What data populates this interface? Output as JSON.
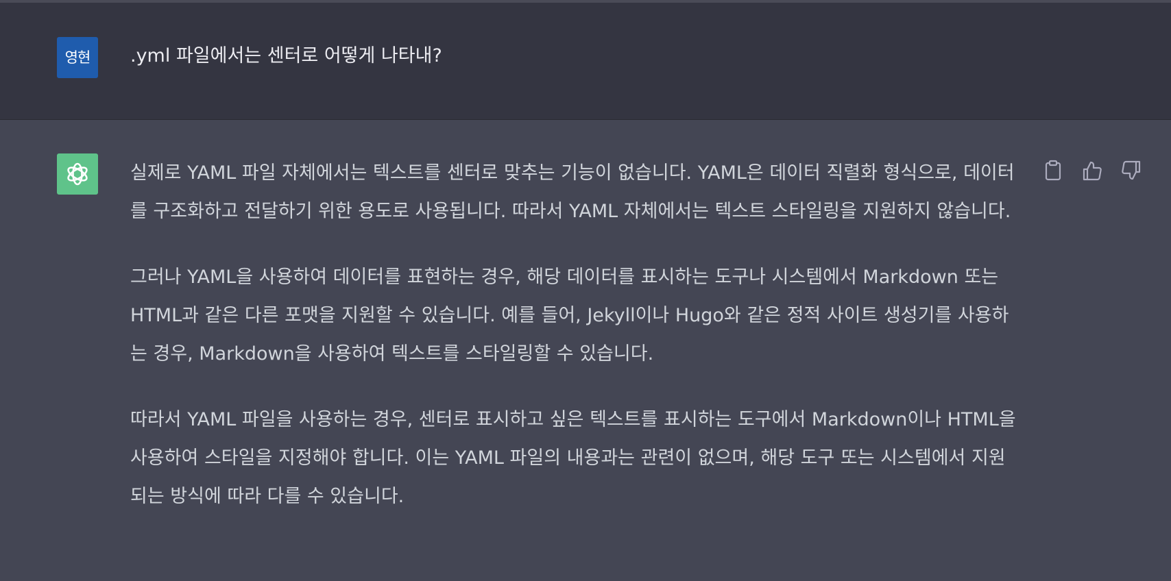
{
  "user_message": {
    "avatar_label": "영현",
    "text": ".yml 파일에서는 센터로 어떻게 나타내?"
  },
  "assistant_message": {
    "paragraphs": [
      "실제로 YAML 파일 자체에서는 텍스트를 센터로 맞추는 기능이 없습니다. YAML은 데이터 직렬화 형식으로, 데이터를 구조화하고 전달하기 위한 용도로 사용됩니다. 따라서 YAML 자체에서는 텍스트 스타일링을 지원하지 않습니다.",
      "그러나 YAML을 사용하여 데이터를 표현하는 경우, 해당 데이터를 표시하는 도구나 시스템에서 Markdown 또는 HTML과 같은 다른 포맷을 지원할 수 있습니다. 예를 들어, Jekyll이나 Hugo와 같은 정적 사이트 생성기를 사용하는 경우, Markdown을 사용하여 텍스트를 스타일링할 수 있습니다.",
      "따라서 YAML 파일을 사용하는 경우, 센터로 표시하고 싶은 텍스트를 표시하는 도구에서 Markdown이나 HTML을 사용하여 스타일을 지정해야 합니다. 이는 YAML 파일의 내용과는 관련이 없으며, 해당 도구 또는 시스템에서 지원되는 방식에 따라 다를 수 있습니다."
    ]
  },
  "actions": {
    "icons": [
      "clipboard-icon",
      "thumbs-up-icon",
      "thumbs-down-icon"
    ]
  },
  "colors": {
    "user_bg": "#343541",
    "assistant_bg": "#444654",
    "user_avatar": "#1f5cad",
    "bot_avatar": "#5fc38a"
  }
}
